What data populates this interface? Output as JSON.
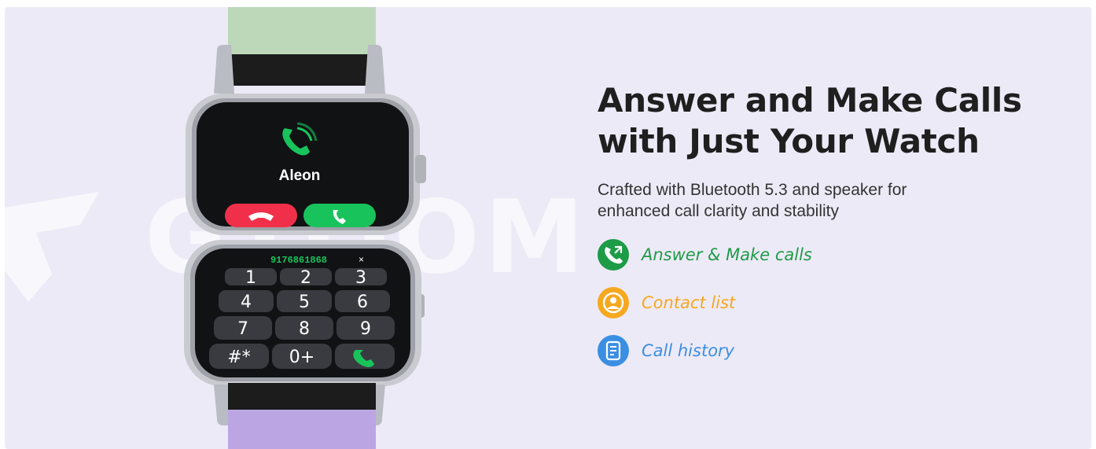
{
  "headline": {
    "line1": "Answer and Make Calls",
    "line2": "with Just Your Watch"
  },
  "subtitle": {
    "line1": "Crafted with Bluetooth 5.3 and speaker for",
    "line2": "enhanced call clarity and stability"
  },
  "features": [
    {
      "label": "Answer & Make calls",
      "icon": "phone-arrows-icon",
      "color": "#1e9b47"
    },
    {
      "label": "Contact list",
      "icon": "contact-person-icon",
      "color": "#f6a81f"
    },
    {
      "label": "Call history",
      "icon": "document-list-icon",
      "color": "#3b8fe3"
    }
  ],
  "watermark": {
    "text": "GTOOM"
  },
  "watch": {
    "caller_name": "Aleon",
    "dialed_number": "9176861868",
    "clear_key": "×",
    "keys": [
      "1",
      "2",
      "3",
      "4",
      "5",
      "6",
      "7",
      "8",
      "9",
      "#*",
      "0+"
    ],
    "band_top_color": "#bcd8b9",
    "band_bottom_color": "#bba6e3",
    "screen_accept_color": "#18c35c",
    "screen_decline_color": "#f0304a"
  },
  "colors": {
    "background": "#edeaf7",
    "headline": "#1f1f1f",
    "subtitle": "#333333"
  }
}
